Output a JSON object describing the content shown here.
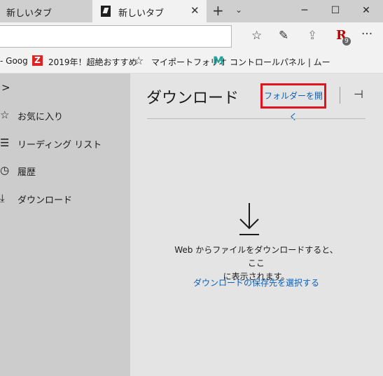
{
  "tabs": [
    {
      "label": "新しいタブ",
      "active": false
    },
    {
      "label": "新しいタブ",
      "active": true
    }
  ],
  "tab_controls": {
    "close_glyph": "✕",
    "new_tab_glyph": "+",
    "tab_list_glyph": "⌄"
  },
  "window_controls": {
    "minimize": "─",
    "maximize": "☐",
    "close": "✕"
  },
  "toolbar": {
    "favorite_glyph": "☆",
    "notes_glyph": "✎",
    "share_glyph": "⇪",
    "rakuten_letter": "R",
    "rakuten_badge": "9",
    "more_glyph": "···"
  },
  "favorites_bar": {
    "items": [
      {
        "label": "- Goog",
        "icon": "google-icon"
      },
      {
        "label": "2019年！超絶おすすめ",
        "icon": "z-icon",
        "icon_text": "Z"
      },
      {
        "label": "マイポートフォリオ",
        "icon": "star-icon",
        "icon_text": "☆"
      },
      {
        "label": "コントロールパネル | ムー",
        "icon": "m-icon",
        "icon_text": "M"
      }
    ]
  },
  "sidebar": {
    "collapse_glyph": ">",
    "items": [
      {
        "label": "お気に入り",
        "icon_glyph": "☆"
      },
      {
        "label": "リーディング リスト",
        "icon_glyph": "☰"
      },
      {
        "label": "履歴",
        "icon_glyph": "◷"
      },
      {
        "label": "ダウンロード",
        "icon_glyph": "⤓"
      }
    ]
  },
  "panel": {
    "title": "ダウンロード",
    "open_folder_label": "フォルダーを開く",
    "pin_glyph": "⊣",
    "empty_message_line1": "Web からファイルをダウンロードすると、ここ",
    "empty_message_line2": "に表示されます。",
    "choose_location_link": "ダウンロードの保存先を選択する"
  },
  "colors": {
    "highlight_border": "#e0141e",
    "link_blue": "#0b5fb8",
    "rakuten_red": "#c00000"
  }
}
